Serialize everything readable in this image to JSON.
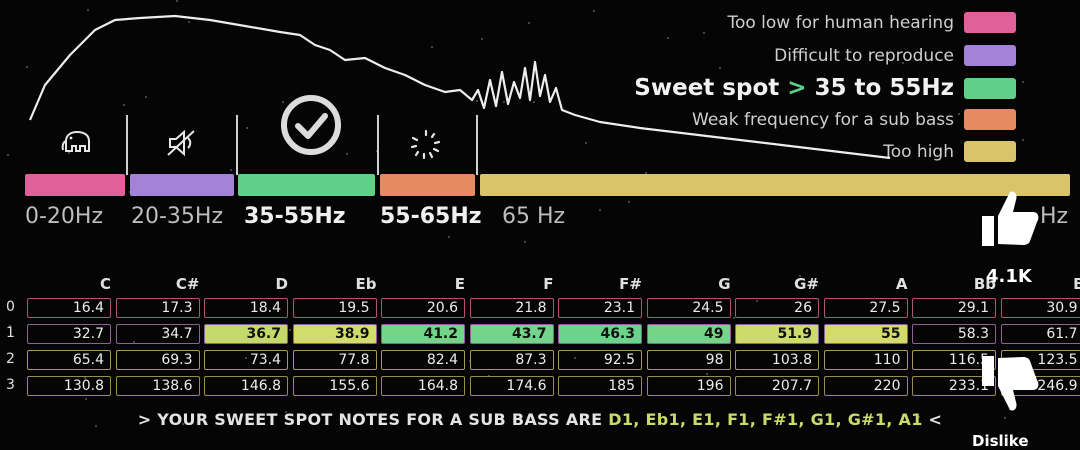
{
  "legend": [
    {
      "label": "Too low for human hearing",
      "color": "#e0609a"
    },
    {
      "label": "Difficult to reproduce",
      "color": "#a383d8"
    },
    {
      "label": "Sweet spot",
      "arrow": ">",
      "range": "35 to 55Hz",
      "color": "#5fd08a"
    },
    {
      "label": "Weak frequency for a sub bass",
      "color": "#e58a63"
    },
    {
      "label": "Too high",
      "color": "#d9c46c"
    }
  ],
  "icons": [
    "elephant-icon",
    "mute-speaker-icon",
    "checkmark-circle-icon",
    "loading-ring-icon"
  ],
  "ranges": [
    "0-20Hz",
    "20-35Hz",
    "35-55Hz",
    "55-65Hz",
    "65 Hz",
    "Hz"
  ],
  "table": {
    "notes": [
      "C",
      "C#",
      "D",
      "Eb",
      "E",
      "F",
      "F#",
      "G",
      "G#",
      "A",
      "Bb",
      "B"
    ],
    "octaves": [
      "0",
      "1",
      "2",
      "3"
    ],
    "rows": [
      [
        "16.4",
        "17.3",
        "18.4",
        "19.5",
        "20.6",
        "21.8",
        "23.1",
        "24.5",
        "26",
        "27.5",
        "29.1",
        "30.9"
      ],
      [
        "32.7",
        "34.7",
        "36.7",
        "38.9",
        "41.2",
        "43.7",
        "46.3",
        "49",
        "51.9",
        "55",
        "58.3",
        "61.7"
      ],
      [
        "65.4",
        "69.3",
        "73.4",
        "77.8",
        "82.4",
        "87.3",
        "92.5",
        "98",
        "103.8",
        "110",
        "116.5",
        "123.5"
      ],
      [
        "130.8",
        "138.6",
        "146.8",
        "155.6",
        "164.8",
        "174.6",
        "185",
        "196",
        "207.7",
        "220",
        "233.1",
        "246.9"
      ]
    ],
    "highlight_colors": [
      "#c5d86a",
      "#d2dc6a",
      "#72d487",
      "#74d48a",
      "#6bd38a",
      "#76d488",
      "#cddb6c",
      "#d3dc6a"
    ]
  },
  "footer": {
    "prefix": "> YOUR SWEET SPOT NOTES FOR A SUB BASS ARE",
    "notes": "D1, Eb1, E1, F1, F#1, G1, G#1, A1",
    "suffix": "<"
  },
  "social": {
    "likes": "4.1K",
    "dislike": "Dislike"
  },
  "colors": {
    "pink": "#e0609a",
    "purple": "#a383d8",
    "green": "#5fd08a",
    "orange": "#e58a63",
    "yellow": "#d9c46c"
  }
}
